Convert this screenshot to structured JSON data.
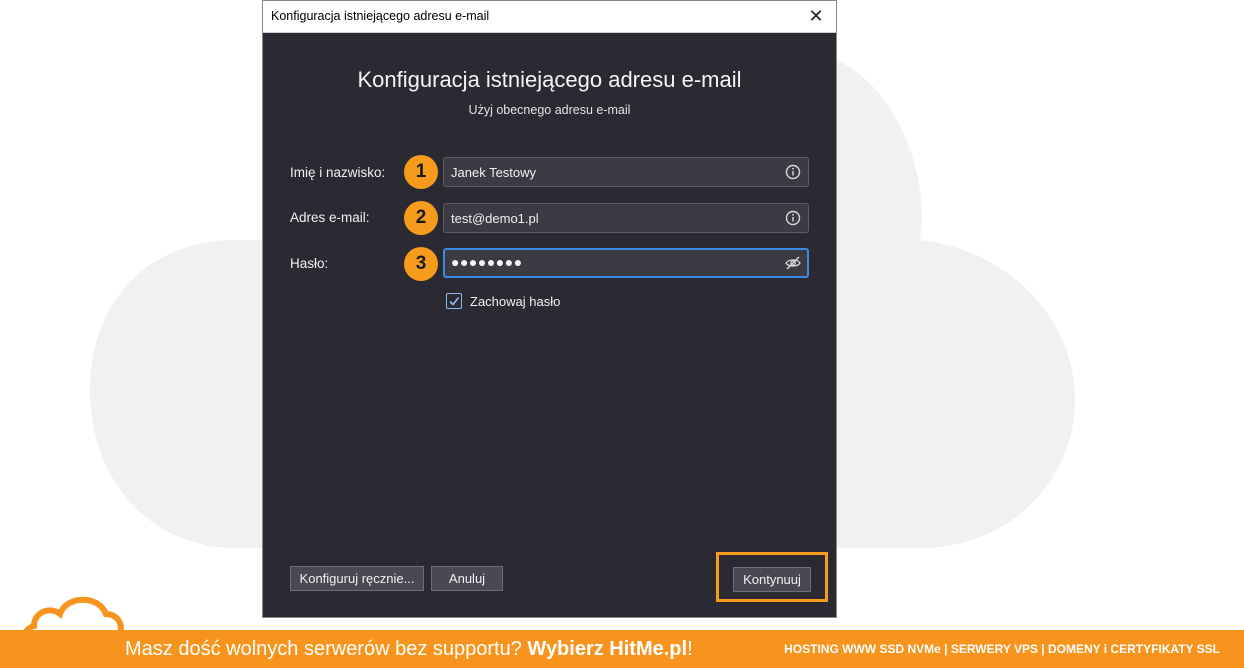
{
  "window": {
    "title": "Konfiguracja istniejącego adresu e-mail",
    "close_label": "✕"
  },
  "dialog": {
    "heading": "Konfiguracja istniejącego adresu e-mail",
    "subheading": "Użyj obecnego adresu e-mail"
  },
  "form": {
    "name": {
      "label": "Imię i nazwisko:",
      "badge": "1",
      "value": "Janek Testowy",
      "icon": "info-icon"
    },
    "email": {
      "label": "Adres e-mail:",
      "badge": "2",
      "value": "test@demo1.pl",
      "icon": "info-icon"
    },
    "password": {
      "label": "Hasło:",
      "badge": "3",
      "value": "●●●●●●●●",
      "icon": "eye-slash-icon"
    },
    "remember": {
      "label": "Zachowaj hasło",
      "checked": true
    }
  },
  "buttons": {
    "manual": "Konfiguruj ręcznie...",
    "cancel": "Anuluj",
    "continue": "Kontynuuj"
  },
  "footer": {
    "promo_text": "Masz dość wolnych serwerów bez supportu?",
    "promo_cta": "Wybierz HitMe.pl",
    "promo_end": "!",
    "services": "HOSTING WWW SSD NVMe | SERWERY VPS | DOMENY i CERTYFIKATY SSL"
  },
  "colors": {
    "accent": "#f59c1d",
    "dialog_bg": "#2b2a33",
    "focus": "#3d89e6",
    "footer_bg": "#f7941d"
  }
}
